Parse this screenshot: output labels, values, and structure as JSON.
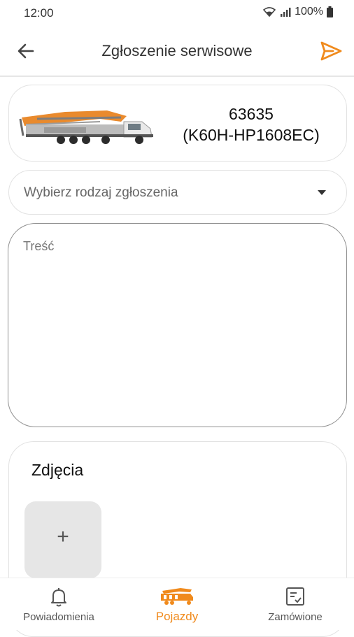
{
  "status_bar": {
    "time": "12:00",
    "battery": "100%",
    "icons": [
      "wifi-icon",
      "signal-icon",
      "battery-icon"
    ]
  },
  "app_bar": {
    "title": "Zgłoszenie serwisowe",
    "back_icon": "arrow-left-icon",
    "send_icon": "send-icon"
  },
  "vehicle": {
    "number": "63635",
    "model": "(K60H-HP1608EC)",
    "image": "concrete-pump-truck"
  },
  "request_type": {
    "placeholder": "Wybierz rodzaj zgłoszenia"
  },
  "content": {
    "label": "Treść",
    "value": ""
  },
  "photos": {
    "title": "Zdjęcia",
    "add_symbol": "+"
  },
  "bottom_nav": {
    "items": [
      {
        "label": "Powiadomienia",
        "icon": "bell-icon",
        "active": false
      },
      {
        "label": "Pojazdy",
        "icon": "truck-icon",
        "active": true
      },
      {
        "label": "Zamówione",
        "icon": "checklist-icon",
        "active": false
      }
    ]
  },
  "colors": {
    "accent": "#f08a1c",
    "border": "#e2e2e2",
    "text_primary": "#222222",
    "text_secondary": "#666666"
  }
}
